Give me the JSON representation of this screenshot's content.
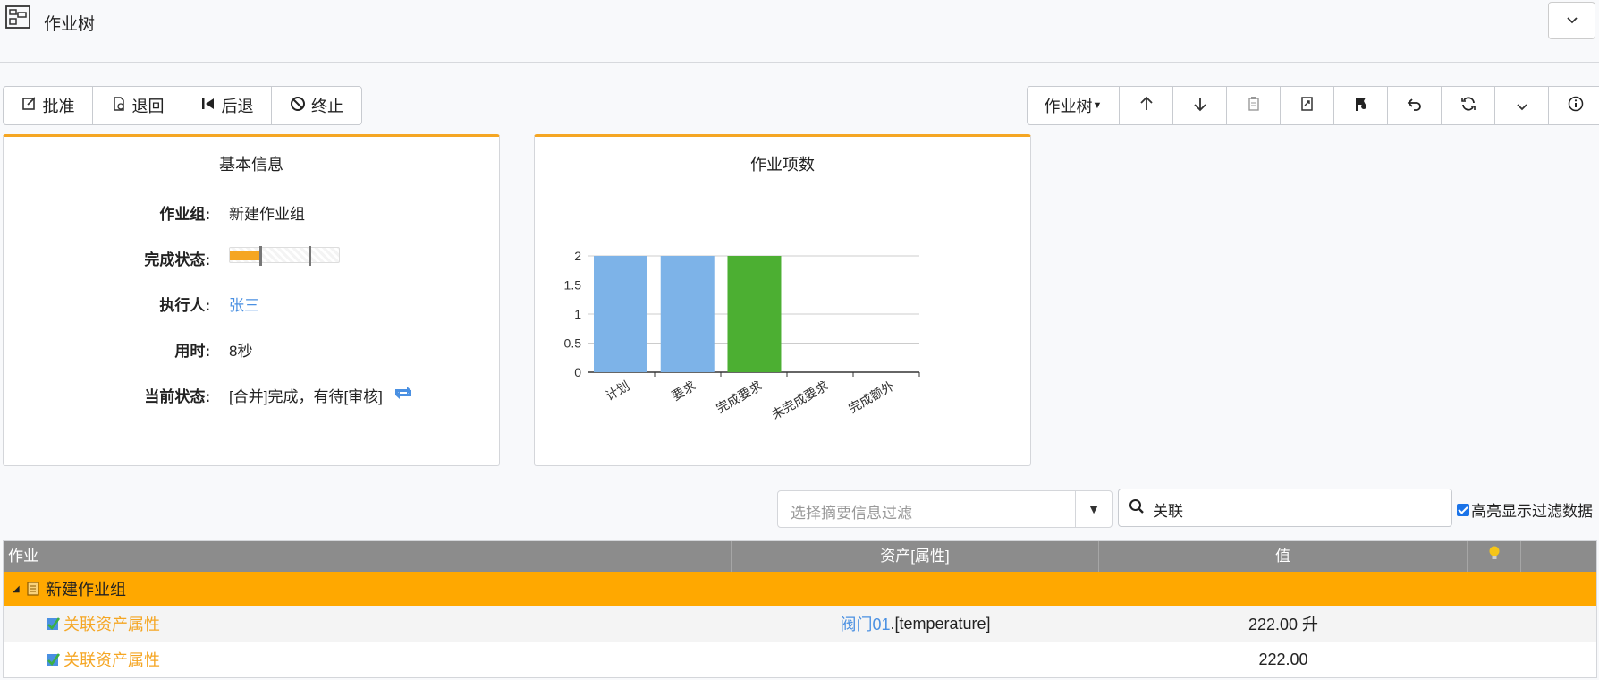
{
  "header": {
    "title": "作业树",
    "app_icon": "tree-grid-icon",
    "collapse_icon": "chevron-down-icon"
  },
  "toolbar_left": [
    {
      "label": "批准",
      "icon": "edit-check-icon"
    },
    {
      "label": "退回",
      "icon": "return-document-icon"
    },
    {
      "label": "后退",
      "icon": "step-back-icon"
    },
    {
      "label": "终止",
      "icon": "ban-icon"
    }
  ],
  "toolbar_right": {
    "dropdown_label": "作业树",
    "icons": [
      "arrow-up-icon",
      "arrow-down-icon",
      "clipboard-icon",
      "copy-icon",
      "flag-icon",
      "undo-icon",
      "refresh-icon",
      "chevron-down-icon",
      "info-icon"
    ]
  },
  "basic_info": {
    "title": "基本信息",
    "rows": [
      {
        "label": "作业组:",
        "value": "新建作业组"
      },
      {
        "label": "完成状态:",
        "progress": 0.27
      },
      {
        "label": "执行人:",
        "value": "张三"
      },
      {
        "label": "用时:",
        "value": "8秒"
      },
      {
        "label": "当前状态:",
        "value": "[合并]完成，有待[审核]"
      }
    ]
  },
  "chart_panel": {
    "title": "作业项数"
  },
  "chart_data": {
    "type": "bar",
    "title": "作业项数",
    "categories": [
      "计划",
      "要求",
      "完成要求",
      "未完成要求",
      "完成额外"
    ],
    "values": [
      2,
      2,
      2,
      0,
      0
    ],
    "colors": [
      "#7db3e8",
      "#7db3e8",
      "#4caf32",
      "#7db3e8",
      "#7db3e8"
    ],
    "ylim": [
      0,
      2
    ],
    "yticks": [
      "0",
      "0.5",
      "1",
      "1.5",
      "2"
    ],
    "grid": true
  },
  "filter": {
    "placeholder": "选择摘要信息过滤",
    "search_value": "关联",
    "highlight_label": "高亮显示过滤数据",
    "highlight_checked": true
  },
  "table": {
    "headers": [
      "作业",
      "资产[属性]",
      "值"
    ],
    "header_icon": "lightbulb-icon",
    "group_row": "新建作业组",
    "rows": [
      {
        "task": "关联资产属性",
        "asset": "阀门01",
        "attr": ".[temperature]",
        "value": "222.00 升"
      },
      {
        "task": "关联资产属性",
        "asset": "",
        "attr": "",
        "value": "222.00"
      }
    ]
  }
}
